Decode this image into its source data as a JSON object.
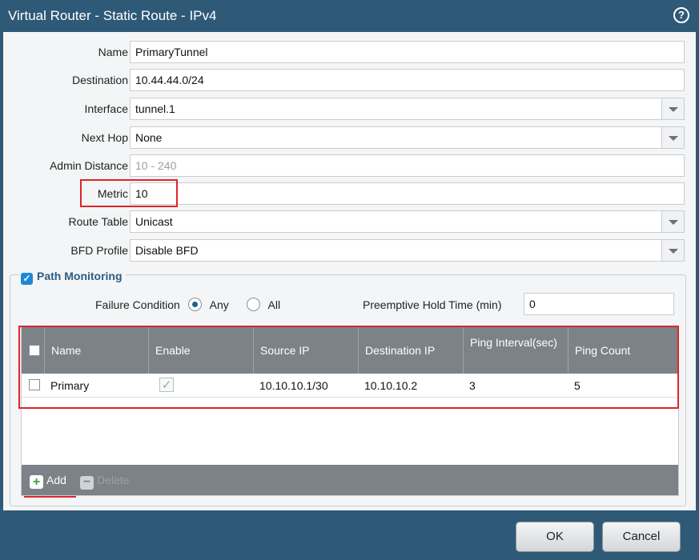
{
  "dialog": {
    "title": "Virtual Router - Static Route - IPv4",
    "help_symbol": "?"
  },
  "fields": {
    "name": {
      "label": "Name",
      "value": "PrimaryTunnel"
    },
    "destination": {
      "label": "Destination",
      "value": "10.44.44.0/24"
    },
    "interface": {
      "label": "Interface",
      "value": "tunnel.1"
    },
    "next_hop": {
      "label": "Next Hop",
      "value": "None"
    },
    "admin_distance": {
      "label": "Admin Distance",
      "placeholder": "10 - 240"
    },
    "metric": {
      "label": "Metric",
      "value": "10"
    },
    "route_table": {
      "label": "Route Table",
      "value": "Unicast"
    },
    "bfd_profile": {
      "label": "BFD Profile",
      "value": "Disable BFD"
    }
  },
  "path_monitoring": {
    "label": "Path Monitoring",
    "checked": true,
    "failure_condition_label": "Failure Condition",
    "option_any": "Any",
    "option_all": "All",
    "selected": "Any",
    "preemptive_label": "Preemptive Hold Time (min)",
    "preemptive_value": "0",
    "columns": [
      "Name",
      "Enable",
      "Source IP",
      "Destination IP",
      "Ping Interval(sec)",
      "Ping Count"
    ],
    "rows": [
      {
        "name": "Primary",
        "enabled": true,
        "source_ip": "10.10.10.1/30",
        "destination_ip": "10.10.10.2",
        "ping_interval": "3",
        "ping_count": "5"
      }
    ],
    "add_label": "Add",
    "delete_label": "Delete"
  },
  "buttons": {
    "ok": "OK",
    "cancel": "Cancel"
  },
  "colors": {
    "accent": "#2e5a78",
    "highlight": "#e0242a",
    "header": "#7c8288"
  }
}
